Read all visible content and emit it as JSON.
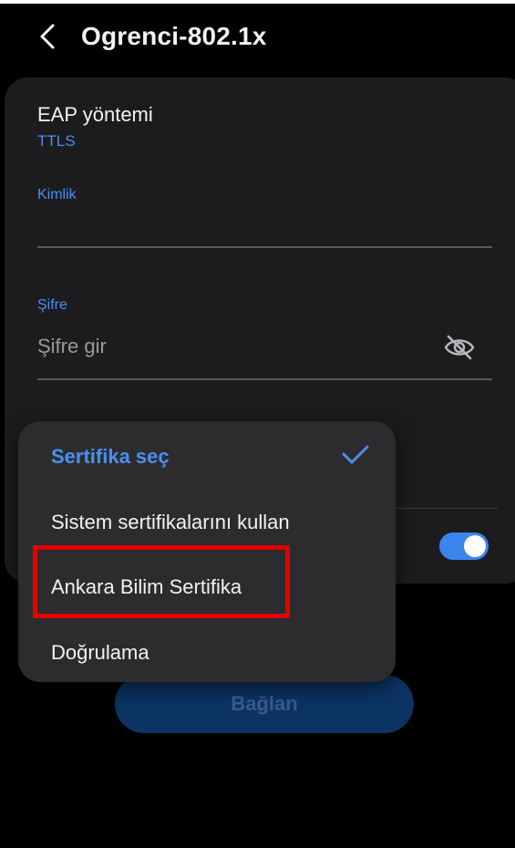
{
  "header": {
    "title": "Ogrenci-802.1x",
    "back_icon": "chevron-left-icon"
  },
  "eap": {
    "label": "EAP yöntemi",
    "value": "TTLS"
  },
  "identity": {
    "label": "Kimlik",
    "value": ""
  },
  "password": {
    "label": "Şifre",
    "placeholder": "Şifre gir",
    "visibility_icon": "eye-off-icon"
  },
  "toggle": {
    "state": "on"
  },
  "certificate_menu": {
    "options": [
      "Sertifika seç",
      "Sistem sertifikalarını kullan",
      "Ankara Bilim Sertifika",
      "Doğrulama"
    ],
    "selected_index": 0,
    "highlighted_option": "Ankara Bilim Sertifika"
  },
  "connect_button": {
    "label": "Bağlan"
  },
  "colors": {
    "accent": "#4b8ff0",
    "card_bg": "#1c1c1e",
    "popup_bg": "#2c2c2e",
    "highlight": "#e00000",
    "toggle_on": "#3b86ee"
  }
}
